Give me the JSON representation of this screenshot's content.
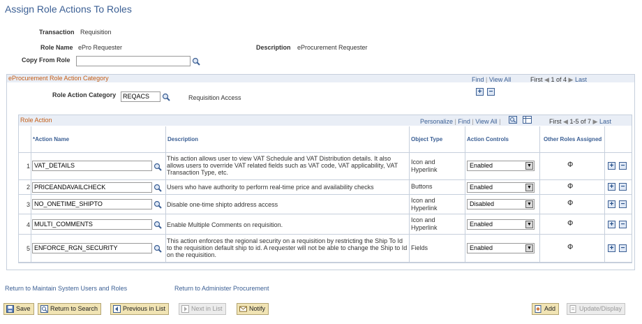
{
  "page_title": "Assign Role Actions To Roles",
  "header": {
    "transaction_label": "Transaction",
    "transaction_value": "Requisition",
    "role_name_label": "Role Name",
    "role_name_value": "ePro Requester",
    "description_label": "Description",
    "description_value": "eProcurement Requester",
    "copy_from_role_label": "Copy From Role",
    "copy_from_role_value": ""
  },
  "category_section": {
    "title": "eProcurement Role Action Category",
    "find": "Find",
    "view_all": "View All",
    "first": "First",
    "count": "1 of 4",
    "last": "Last",
    "role_action_category_label": "Role Action Category",
    "role_action_category_value": "REQACS",
    "role_action_category_desc": "Requisition Access"
  },
  "grid": {
    "title": "Role Action",
    "personalize": "Personalize",
    "find": "Find",
    "view_all": "View All",
    "first": "First",
    "count": "1-5 of 7",
    "last": "Last",
    "columns": {
      "action_name": "*Action Name",
      "description": "Description",
      "object_type": "Object Type",
      "action_controls": "Action Controls",
      "other_roles": "Other Roles Assigned"
    },
    "rows": [
      {
        "num": "1",
        "action": "VAT_DETAILS",
        "description": "This action allows user to view VAT Schedule and VAT Distribution details. It also allows users to override VAT related fields such as VAT code, VAT applicability, VAT Transaction Type, etc.",
        "object_type": "Icon and Hyperlink",
        "control": "Enabled"
      },
      {
        "num": "2",
        "action": "PRICEANDAVAILCHECK",
        "description": "Users who have authority to perform real-time price and availability checks",
        "object_type": "Buttons",
        "control": "Enabled"
      },
      {
        "num": "3",
        "action": "NO_ONETIME_SHIPTO",
        "description": "Disable one-time shipto address access",
        "object_type": "Icon and Hyperlink",
        "control": "Disabled"
      },
      {
        "num": "4",
        "action": "MULTI_COMMENTS",
        "description": "Enable Multiple Comments on requisition.",
        "object_type": "Icon and Hyperlink",
        "control": "Enabled"
      },
      {
        "num": "5",
        "action": "ENFORCE_RGN_SECURITY",
        "description": "This action enforces the regional security on a requisition by restricting the Ship To Id to the requisition default ship to id.  A requester will not be able to change the Ship to Id on the requisition.",
        "object_type": "Fields",
        "control": "Enabled"
      }
    ]
  },
  "links": {
    "return_users": "Return to Maintain System Users and Roles",
    "return_admin": "Return to Administer Procurement"
  },
  "toolbar": {
    "save": "Save",
    "return_to_search": "Return to Search",
    "previous_in_list": "Previous in List",
    "next_in_list": "Next in List",
    "notify": "Notify",
    "add": "Add",
    "update_display": "Update/Display"
  }
}
